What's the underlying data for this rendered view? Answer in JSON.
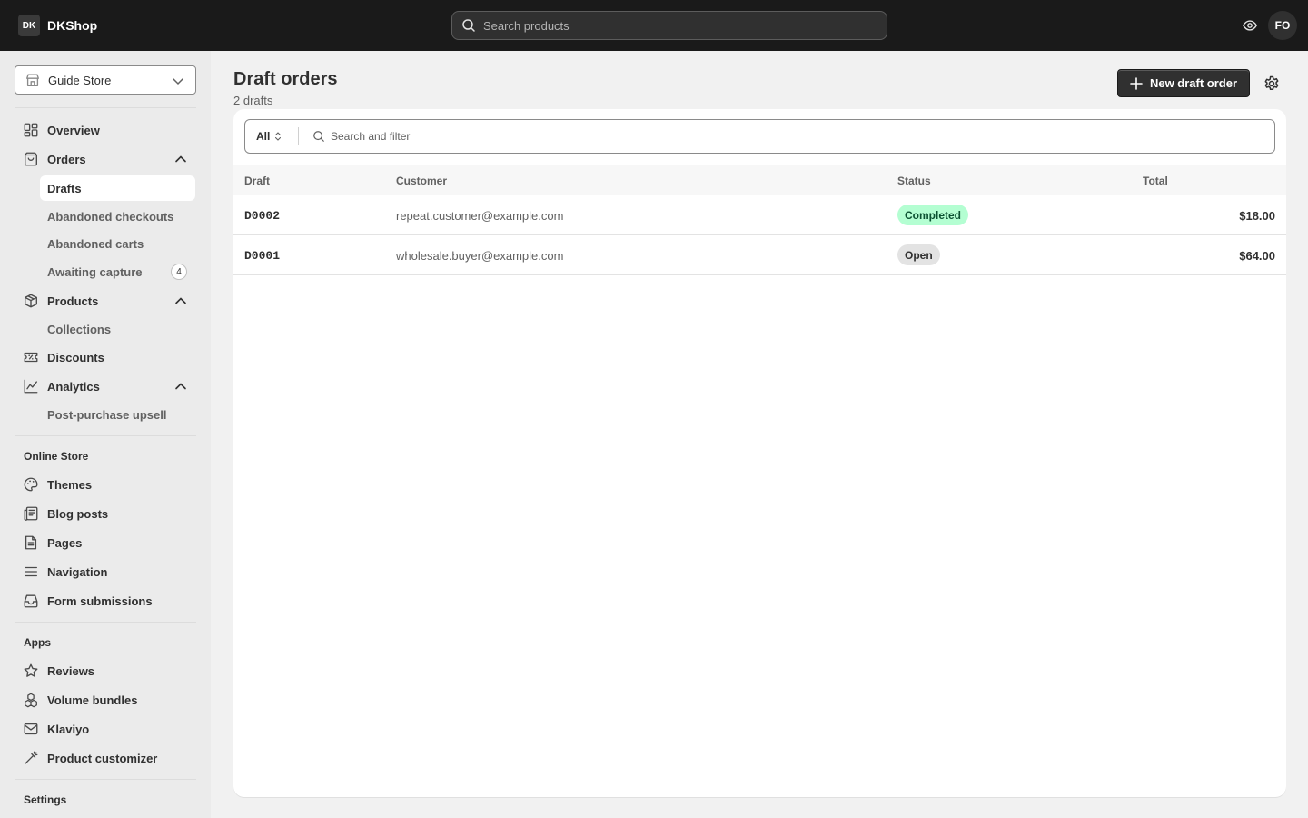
{
  "app": {
    "brand_logo": "DK",
    "brand_name": "DKShop",
    "search_placeholder": "Search products",
    "avatar_initials": "FO"
  },
  "sidebar": {
    "store_name": "Guide Store",
    "nav": {
      "overview": "Overview",
      "orders": "Orders",
      "products": "Products",
      "discounts": "Discounts",
      "analytics": "Analytics"
    },
    "orders_sub": {
      "drafts": "Drafts",
      "abandoned_checkouts": "Abandoned checkouts",
      "abandoned_carts": "Abandoned carts",
      "awaiting_capture": "Awaiting capture",
      "awaiting_capture_count": "4"
    },
    "products_sub": {
      "collections": "Collections"
    },
    "analytics_sub": {
      "post_purchase": "Post-purchase upsell"
    },
    "online_store": {
      "title": "Online Store",
      "themes": "Themes",
      "blog_posts": "Blog posts",
      "pages": "Pages",
      "navigation": "Navigation",
      "form_submissions": "Form submissions"
    },
    "apps": {
      "title": "Apps",
      "reviews": "Reviews",
      "volume_bundles": "Volume bundles",
      "klaviyo": "Klaviyo",
      "product_customizer": "Product customizer"
    },
    "settings_title": "Settings"
  },
  "main": {
    "title": "Draft orders",
    "subtitle": "2 drafts",
    "new_button": "New draft order",
    "filter_tab": "All",
    "filter_placeholder": "Search and filter",
    "columns": {
      "draft": "Draft",
      "customer": "Customer",
      "status": "Status",
      "total": "Total"
    },
    "rows": [
      {
        "id": "D0002",
        "customer": "repeat.customer@example.com",
        "status": "Completed",
        "total": "$18.00"
      },
      {
        "id": "D0001",
        "customer": "wholesale.buyer@example.com",
        "status": "Open",
        "total": "$64.00"
      }
    ]
  },
  "colors": {
    "topbar": "#1a1a1a",
    "status_completed_bg": "#b4fed2",
    "status_completed_text": "#0c5132",
    "status_open_bg": "#e3e3e3",
    "status_open_text": "#303030"
  }
}
